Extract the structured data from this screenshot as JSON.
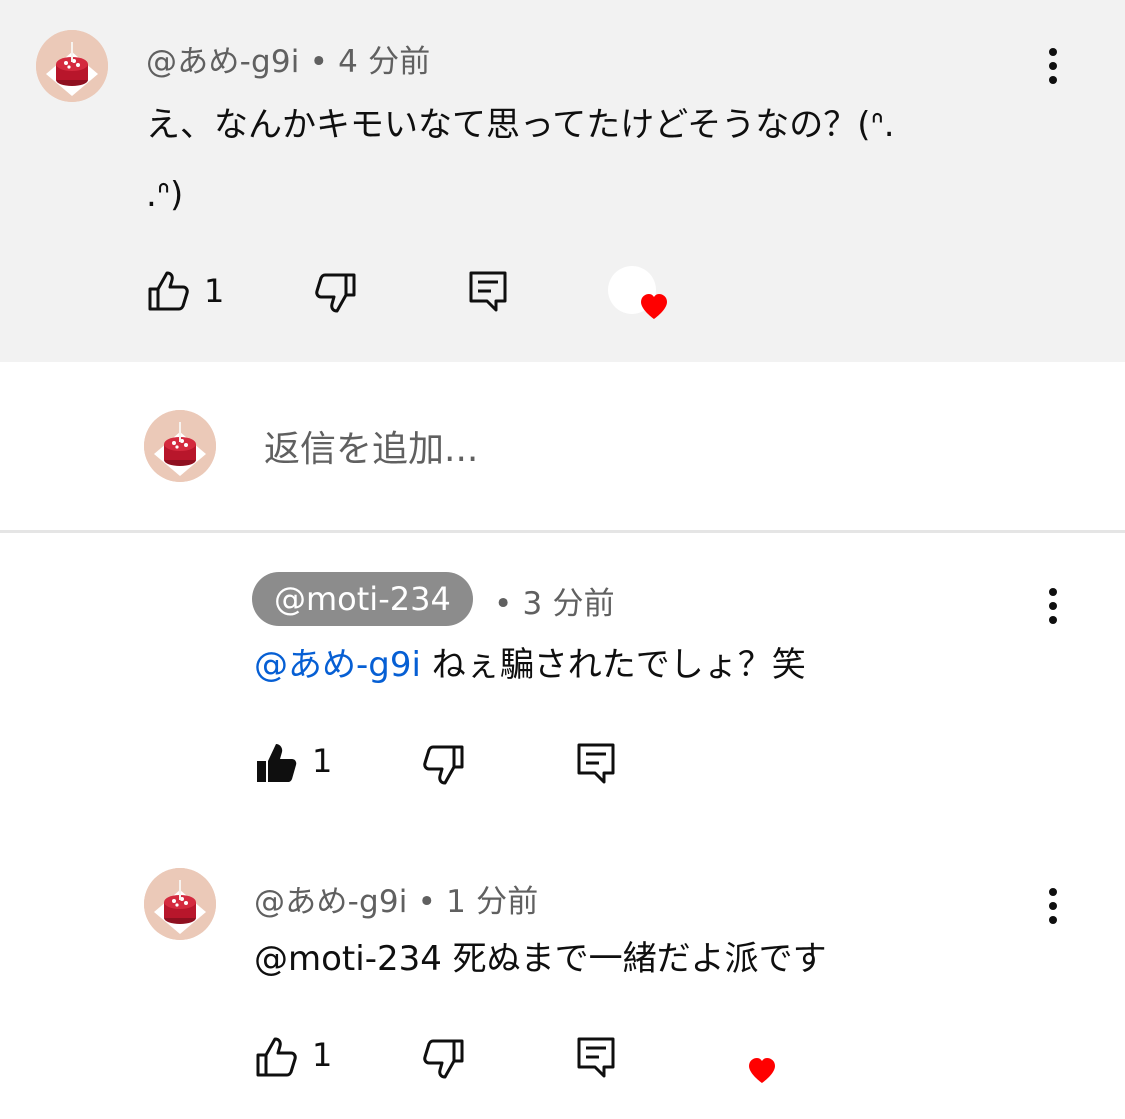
{
  "comments": [
    {
      "author": "@あめ-g9i",
      "separator": "•",
      "time": "4 分前",
      "text_line1": "え、なんかキモいなて思ってたけどそうなの？(ᐢ.",
      "text_line2": ".ᐢ)",
      "likes": "1",
      "creator_hearted": true
    }
  ],
  "reply_input": {
    "placeholder": "返信を追加..."
  },
  "replies": [
    {
      "author": "@moti-234",
      "separator": "•",
      "time": "3 分前",
      "mention": "@あめ-g9i",
      "text": " ねぇ騙されたでしょ？笑",
      "likes": "1",
      "liked": true
    },
    {
      "author": "@あめ-g9i",
      "separator": "•",
      "time": "1 分前",
      "text": "@moti-234 死ぬまで一緒だよ派です",
      "likes": "1",
      "creator_hearted": true
    }
  ],
  "colors": {
    "heart": "#ff0000",
    "mention": "#065fd4",
    "highlight_bg": "#f2f2f2"
  },
  "icons": [
    "avatar-cake",
    "thumbs-up-icon",
    "thumbs-down-icon",
    "reply-icon",
    "more-vert-icon",
    "heart-icon"
  ]
}
